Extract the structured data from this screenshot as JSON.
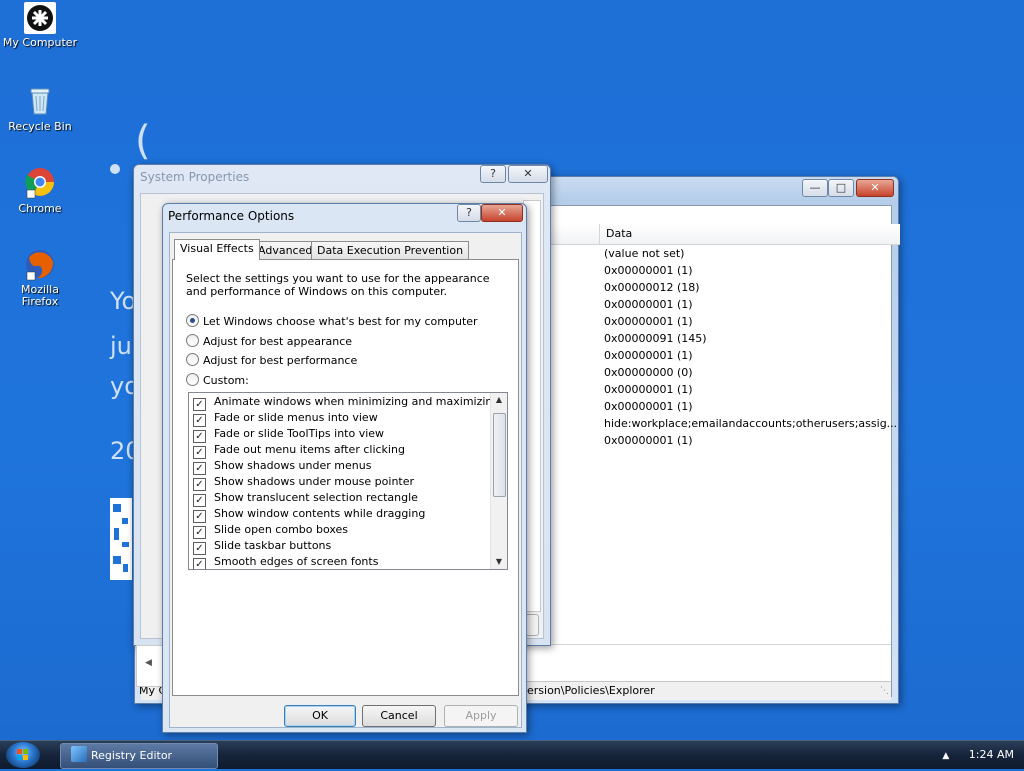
{
  "desktop": {
    "icons": [
      {
        "label": "My Computer",
        "icon": "computer-icon"
      },
      {
        "label": "Recycle Bin",
        "icon": "recycle-bin-icon"
      },
      {
        "label": "Chrome",
        "icon": "chrome-icon"
      },
      {
        "label": "Mozilla\nFirefox",
        "icon": "firefox-icon"
      }
    ],
    "background_text": [
      "(",
      "Yo",
      "jus",
      "yo",
      "20"
    ]
  },
  "registry_window": {
    "column_header": "Data",
    "values": [
      "(value not set)",
      "0x00000001 (1)",
      "0x00000012 (18)",
      "0x00000001 (1)",
      "0x00000001 (1)",
      "0x00000091 (145)",
      "0x00000001 (1)",
      "0x00000000 (0)",
      "0x00000001 (1)",
      "0x00000001 (1)",
      "hide:workplace;emailandaccounts;otherusers;assig...",
      "0x00000001 (1)"
    ],
    "status_path": "ersion\\Policies\\Explorer",
    "status_left": "My C"
  },
  "system_properties": {
    "title": "System Properties"
  },
  "performance_options": {
    "title": "Performance Options",
    "tabs": [
      "Visual Effects",
      "Advanced",
      "Data Execution Prevention"
    ],
    "active_tab": "Visual Effects",
    "description": "Select the settings you want to use for the appearance and performance of Windows on this computer.",
    "radios": [
      {
        "label": "Let Windows choose what's best for my computer",
        "selected": true
      },
      {
        "label": "Adjust for best appearance",
        "selected": false
      },
      {
        "label": "Adjust for best performance",
        "selected": false
      },
      {
        "label": "Custom:",
        "selected": false
      }
    ],
    "effects": [
      {
        "label": "Animate windows when minimizing and maximizing",
        "checked": true
      },
      {
        "label": "Fade or slide menus into view",
        "checked": true
      },
      {
        "label": "Fade or slide ToolTips into view",
        "checked": true
      },
      {
        "label": "Fade out menu items after clicking",
        "checked": true
      },
      {
        "label": "Show shadows under menus",
        "checked": true
      },
      {
        "label": "Show shadows under mouse pointer",
        "checked": true
      },
      {
        "label": "Show translucent selection rectangle",
        "checked": true
      },
      {
        "label": "Show window contents while dragging",
        "checked": true
      },
      {
        "label": "Slide open combo boxes",
        "checked": true
      },
      {
        "label": "Slide taskbar buttons",
        "checked": true
      },
      {
        "label": "Smooth edges of screen fonts",
        "checked": true
      }
    ],
    "buttons": {
      "ok": "OK",
      "cancel": "Cancel",
      "apply": "Apply"
    }
  },
  "taskbar": {
    "task": "Registry Editor",
    "clock": "1:24 AM"
  },
  "colors": {
    "desktop": "#1f73d8",
    "taskbar": "#16243a",
    "accent": "#3c7fb1"
  }
}
